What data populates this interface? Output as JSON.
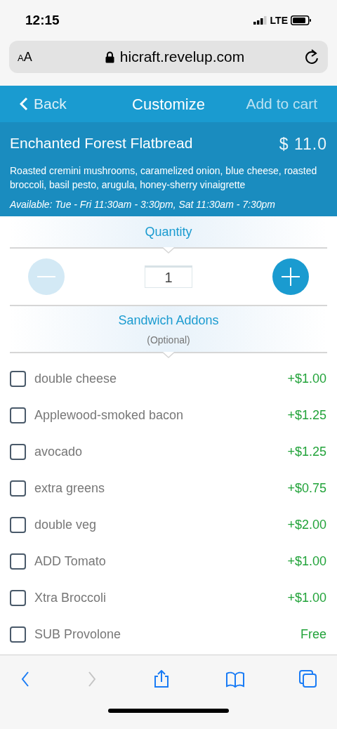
{
  "status_bar": {
    "time": "12:15",
    "network": "LTE"
  },
  "url_bar": {
    "text_size": "AA",
    "url": "hicraft.revelup.com"
  },
  "nav": {
    "back": "Back",
    "title": "Customize",
    "action": "Add to cart"
  },
  "item": {
    "name": "Enchanted Forest Flatbread",
    "price": "$ 11.0",
    "description": "Roasted cremini mushrooms, caramelized onion, blue cheese, roasted broccoli, basil pesto, arugula, honey-sherry vinaigrette",
    "availability": "Available: Tue - Fri 11:30am - 3:30pm, Sat 11:30am - 7:30pm"
  },
  "quantity": {
    "title": "Quantity",
    "value": "1",
    "decrease_disabled": true,
    "increase_disabled": false
  },
  "addons": {
    "title": "Sandwich Addons",
    "subtitle": "(Optional)",
    "items": [
      {
        "label": "double cheese",
        "price": "+$1.00",
        "checked": false
      },
      {
        "label": "Applewood-smoked bacon",
        "price": "+$1.25",
        "checked": false
      },
      {
        "label": "avocado",
        "price": "+$1.25",
        "checked": false
      },
      {
        "label": "extra greens",
        "price": "+$0.75",
        "checked": false
      },
      {
        "label": "double veg",
        "price": "+$2.00",
        "checked": false
      },
      {
        "label": "ADD Tomato",
        "price": "+$1.00",
        "checked": false
      },
      {
        "label": "Xtra Broccoli",
        "price": "+$1.00",
        "checked": false
      },
      {
        "label": "SUB Provolone",
        "price": "Free",
        "checked": false
      }
    ]
  },
  "toolbar": [
    {
      "kind": "back",
      "disabled": false
    },
    {
      "kind": "forward",
      "disabled": true
    },
    {
      "kind": "share",
      "disabled": false
    },
    {
      "kind": "bookmarks",
      "disabled": false
    },
    {
      "kind": "tabs",
      "disabled": false
    }
  ]
}
